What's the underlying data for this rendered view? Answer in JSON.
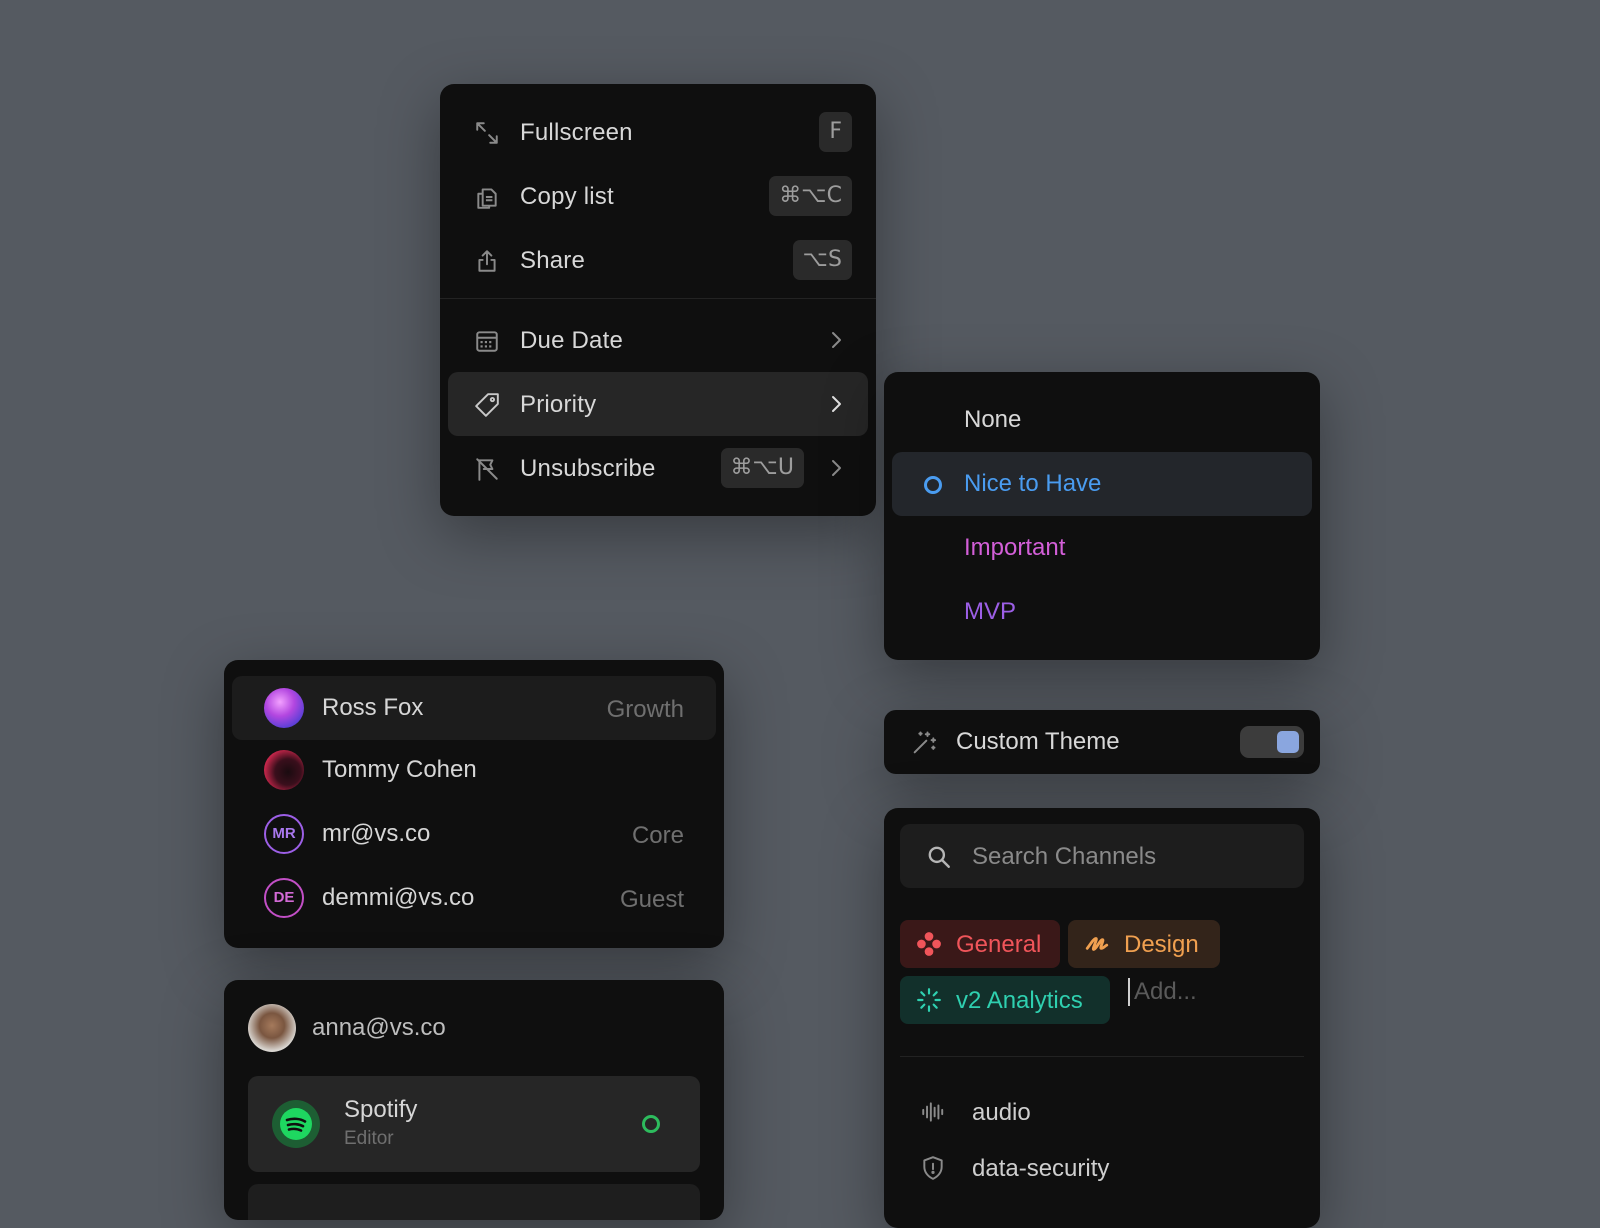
{
  "menu": {
    "items": [
      {
        "label": "Fullscreen",
        "shortcut": "F",
        "icon": "expand-icon"
      },
      {
        "label": "Copy list",
        "shortcut": "⌘⌥C",
        "icon": "copy-icon"
      },
      {
        "label": "Share",
        "shortcut": "⌥S",
        "icon": "share-icon"
      },
      {
        "label": "Due Date",
        "icon": "calendar-icon"
      },
      {
        "label": "Priority",
        "icon": "tag-icon",
        "highlighted": true
      },
      {
        "label": "Unsubscribe",
        "shortcut": "⌘⌥U",
        "icon": "flag-off-icon"
      }
    ]
  },
  "priority": {
    "options": [
      {
        "label": "None",
        "color": "#d8d8d8"
      },
      {
        "label": "Nice to Have",
        "color": "#4a9cf0",
        "selected": true
      },
      {
        "label": "Important",
        "color": "#d35fd8"
      },
      {
        "label": "MVP",
        "color": "#9c5fe6"
      }
    ]
  },
  "theme": {
    "label": "Custom Theme",
    "enabled": true,
    "icon": "magic-wand-icon"
  },
  "users": [
    {
      "name": "Ross Fox",
      "team": "Growth",
      "avatar": "photo"
    },
    {
      "name": "Tommy Cohen",
      "team": "",
      "avatar": "photo"
    },
    {
      "name": "mr@vs.co",
      "team": "Core",
      "initials": "MR",
      "color": "#9c5fe6"
    },
    {
      "name": "demmi@vs.co",
      "team": "Guest",
      "initials": "DE",
      "color": "#c24fc6"
    }
  ],
  "account": {
    "email": "anna@vs.co",
    "apps": [
      {
        "name": "Spotify",
        "role": "Editor",
        "status_color": "#2dbb5d",
        "icon": "spotify-icon"
      }
    ]
  },
  "channels": {
    "search_placeholder": "Search Channels",
    "tags": [
      {
        "label": "General",
        "color": "#f0555a",
        "bg": "#3a1818",
        "icon": "dots-icon"
      },
      {
        "label": "Design",
        "color": "#f0a050",
        "bg": "#33241a",
        "icon": "pen-icon"
      },
      {
        "label": "v2 Analytics",
        "color": "#2fd0b0",
        "bg": "#12302b",
        "icon": "loader-icon"
      }
    ],
    "add_placeholder": "Add...",
    "list": [
      {
        "label": "audio",
        "icon": "waveform-icon"
      },
      {
        "label": "data-security",
        "icon": "shield-icon"
      }
    ]
  }
}
